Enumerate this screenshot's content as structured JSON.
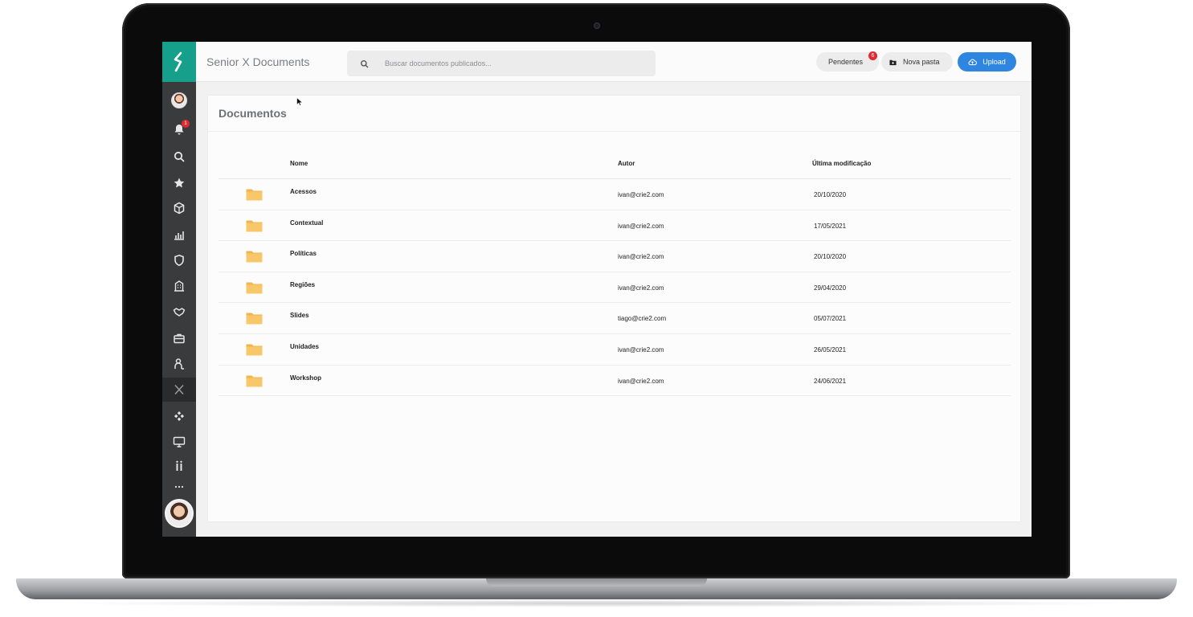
{
  "app": {
    "title": "Senior X Documents"
  },
  "search": {
    "placeholder": "Buscar documentos publicados..."
  },
  "header": {
    "pending_label": "Pendentes",
    "pending_count": "6",
    "new_folder_label": "Nova pasta",
    "upload_label": "Upload"
  },
  "sidebar": {
    "notification_count": "1",
    "items": [
      {
        "icon": "user-avatar-icon"
      },
      {
        "icon": "bell-icon"
      },
      {
        "icon": "search-icon"
      },
      {
        "icon": "star-icon"
      },
      {
        "icon": "cube-icon"
      },
      {
        "icon": "chart-icon"
      },
      {
        "icon": "shield-icon"
      },
      {
        "icon": "building-icon"
      },
      {
        "icon": "handshake-icon"
      },
      {
        "icon": "briefcase-icon"
      },
      {
        "icon": "person-icon"
      },
      {
        "icon": "x-icon"
      },
      {
        "icon": "diamond-icon"
      },
      {
        "icon": "monitor-icon"
      },
      {
        "icon": "pause-icon"
      },
      {
        "icon": "more-icon"
      }
    ]
  },
  "documents": {
    "title": "Documentos",
    "columns": {
      "name": "Nome",
      "author": "Autor",
      "modified": "Última modificação"
    },
    "rows": [
      {
        "name": "Acessos",
        "author": "ivan@crie2.com",
        "modified": "20/10/2020"
      },
      {
        "name": "Contextual",
        "author": "ivan@crie2.com",
        "modified": "17/05/2021"
      },
      {
        "name": "Políticas",
        "author": "ivan@crie2.com",
        "modified": "20/10/2020"
      },
      {
        "name": "Regiões",
        "author": "ivan@crie2.com",
        "modified": "29/04/2020"
      },
      {
        "name": "Slides",
        "author": "tiago@crie2.com",
        "modified": "05/07/2021"
      },
      {
        "name": "Unidades",
        "author": "ivan@crie2.com",
        "modified": "26/05/2021"
      },
      {
        "name": "Workshop",
        "author": "ivan@crie2.com",
        "modified": "24/06/2021"
      }
    ]
  },
  "colors": {
    "brand": "#16a08b",
    "sidebar": "#3a3b3d",
    "upload_button": "#2e86e0",
    "badge": "#e02a33",
    "folder": "#f3b450"
  }
}
